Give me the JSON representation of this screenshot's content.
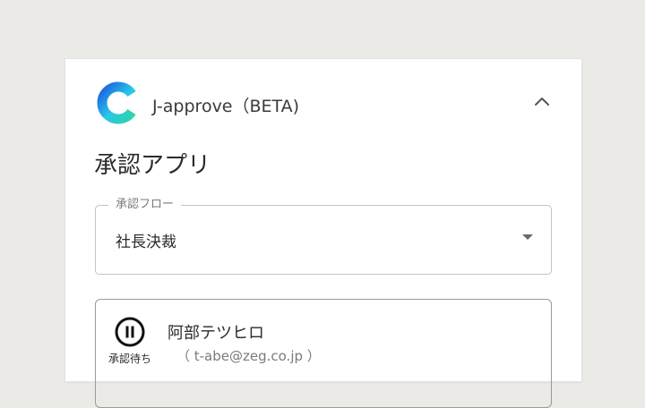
{
  "app": {
    "title": "J-approve（BETA)"
  },
  "page": {
    "title": "承認アプリ"
  },
  "flow_select": {
    "label": "承認フロー",
    "value": "社長決裁"
  },
  "approver": {
    "name": "阿部テツヒロ",
    "email": "（ t-abe@zeg.co.jp ）",
    "status": "承認待ち",
    "status_icon": "pause-circle-icon"
  },
  "colors": {
    "background": "#ebeae7",
    "card": "#ffffff",
    "logo_blue_dark": "#1d5fe0",
    "logo_blue_light": "#28c8e8",
    "logo_green": "#2fd3a7"
  }
}
